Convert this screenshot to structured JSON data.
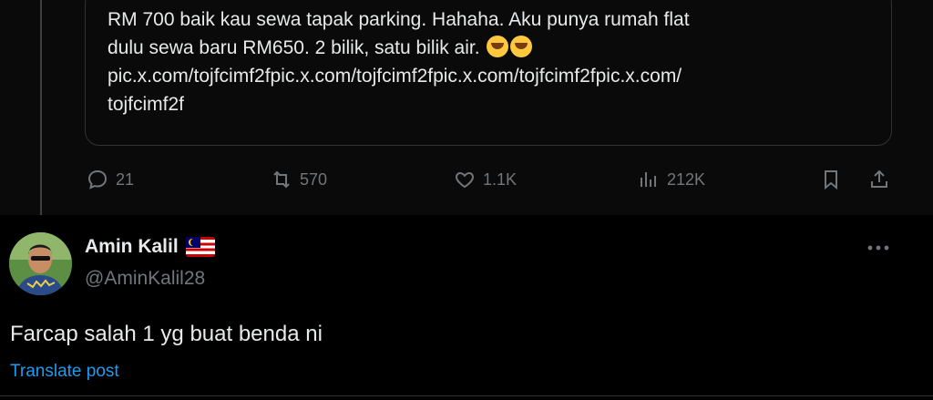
{
  "quoted_post": {
    "line1": "RM 700 baik kau sewa tapak parking. Hahaha. Aku punya rumah flat",
    "line2": "dulu sewa baru RM650. 2 bilik, satu bilik air.",
    "emoji_icon": "rolling-on-floor-laughing-emoji",
    "line3": "pic.x.com/tojfcimf2fpic.x.com/tojfcimf2fpic.x.com/tojfcimf2fpic.x.com/",
    "line4": "tojfcimf2f"
  },
  "actions": {
    "replies": "21",
    "reposts": "570",
    "likes": "1.1K",
    "views": "212K"
  },
  "reply_post": {
    "author_name": "Amin Kalil",
    "author_handle": "@AminKalil28",
    "text": "Farcap salah 1 yg buat benda ni",
    "translate_label": "Translate post",
    "flag_icon": "malaysia-flag-icon"
  },
  "colors": {
    "background": "#000000",
    "text_primary": "#e7e9ea",
    "text_secondary": "#71767b",
    "link": "#1d9bf0",
    "border": "#2f3336"
  }
}
